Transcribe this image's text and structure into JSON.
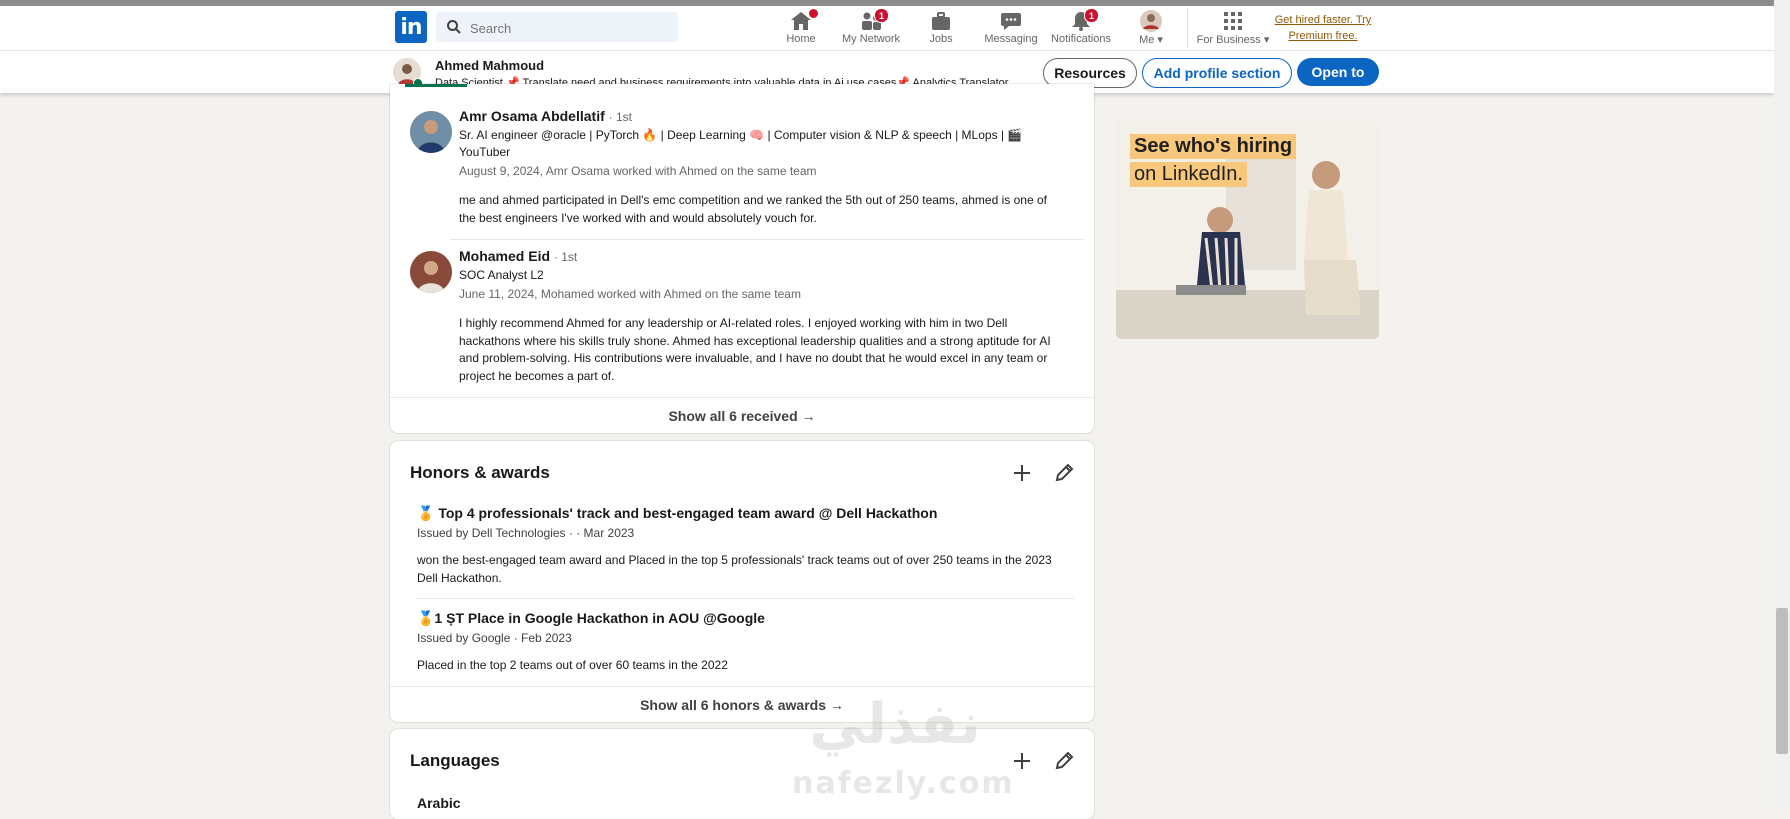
{
  "nav": {
    "search_placeholder": "Search",
    "items": [
      {
        "label": "Home",
        "icon": "home-icon",
        "badge": "0"
      },
      {
        "label": "My Network",
        "icon": "network-icon",
        "badge": "1"
      },
      {
        "label": "Jobs",
        "icon": "briefcase-icon",
        "badge": ""
      },
      {
        "label": "Messaging",
        "icon": "chat-icon",
        "badge": ""
      },
      {
        "label": "Notifications",
        "icon": "bell-icon",
        "badge": "1"
      },
      {
        "label": "Me",
        "icon": "avatar-icon",
        "badge": ""
      },
      {
        "label": "For Business",
        "icon": "grid-icon",
        "badge": ""
      }
    ],
    "premium_line1": "Get hired faster. Try",
    "premium_line2": "Premium free."
  },
  "profile_bar": {
    "name": "Ahmed Mahmoud",
    "headline_part1": "Data Scientist",
    "headline_part2": "Translate need and business requirements into valuable data in Ai use cases",
    "headline_part3": "Analytics Translator",
    "btn_resources": "Resources",
    "btn_add_section": "Add profile section",
    "btn_open_to": "Open to"
  },
  "recommendations": {
    "items": [
      {
        "name": "Amr Osama Abdellatif",
        "degree": "· 1st",
        "subtitle": "Sr. AI engineer @oracle | PyTorch 🔥 | Deep Learning 🧠 | Computer vision & NLP & speech | MLops | 🎬 YouTuber",
        "date": "August 9, 2024, Amr Osama worked with Ahmed on the same team",
        "text": "me and ahmed participated in Dell's emc competition and we ranked the 5th out of 250 teams, ahmed is one of the best engineers I've worked with and would absolutely vouch for."
      },
      {
        "name": "Mohamed Eid",
        "degree": "· 1st",
        "subtitle": "SOC Analyst L2",
        "date": "June 11, 2024, Mohamed worked with Ahmed on the same team",
        "text": "I highly recommend Ahmed for any leadership or AI-related roles. I enjoyed working with him in two Dell hackathons where his skills truly shone. Ahmed has exceptional leadership qualities and a strong aptitude for AI and problem-solving. His contributions were invaluable, and I have no doubt that he would excel in any team or project he becomes a part of."
      }
    ],
    "show_all": "Show all 6 received →"
  },
  "honors": {
    "title": "Honors & awards",
    "items": [
      {
        "title": "🏅 Top 4 professionals' track and best-engaged team award @ Dell Hackathon",
        "issued": "Issued by Dell Technologies · · Mar 2023",
        "desc": "won the best-engaged team award and Placed in the top 5 professionals' track teams out of over 250 teams in the 2023 Dell Hackathon."
      },
      {
        "title": "🏅1 ȘT Place in Google Hackathon in AOU @Google",
        "issued": "Issued by Google · Feb 2023",
        "desc": "Placed in the top 2 teams out of over 60 teams in the 2022"
      }
    ],
    "show_all": "Show all 6 honors & awards →"
  },
  "languages": {
    "title": "Languages",
    "first": "Arabic"
  },
  "ad": {
    "line1": "See who's hiring",
    "line2": "on LinkedIn."
  },
  "watermark": {
    "arabic": "نفذلي",
    "latin": "nafezly.com"
  },
  "colors": {
    "linkedin_blue": "#0a66c2",
    "badge_red": "#cb112d",
    "premium_gold": "#915907",
    "online_green": "#01754f",
    "page_bg": "#f4f2ee"
  }
}
